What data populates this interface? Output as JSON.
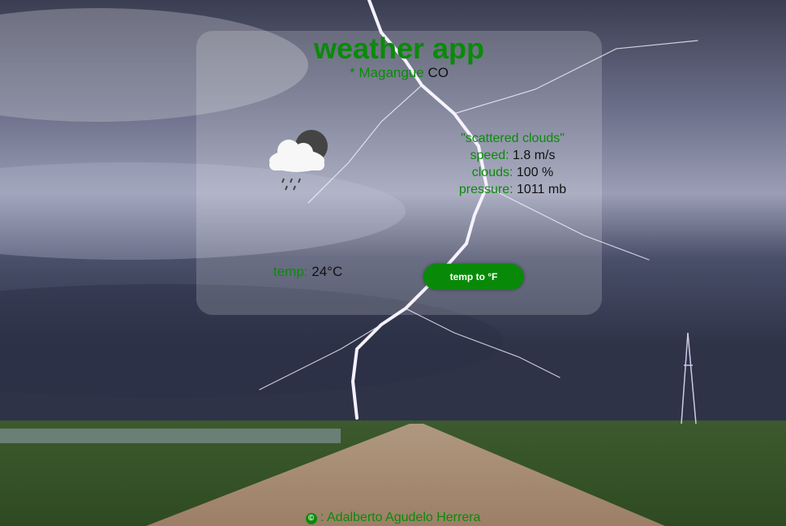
{
  "app": {
    "title": "weather app",
    "location_prefix": "* Magangue",
    "location_country": "CO"
  },
  "weather": {
    "description": "\"scattered clouds\"",
    "speed_label": "speed:",
    "speed_value": "1.8 m/s",
    "clouds_label": "clouds:",
    "clouds_value": "100 %",
    "pressure_label": "pressure:",
    "pressure_value": "1011 mb",
    "icon": "cloud-rain-icon"
  },
  "temperature": {
    "label": "temp:",
    "value": "24°C",
    "toggle_button": "temp to °F"
  },
  "footer": {
    "icon": "copyright-icon",
    "author": ": Adalberto Agudelo Herrera"
  },
  "colors": {
    "accent": "#0a8a0a",
    "button": "#088a08"
  }
}
